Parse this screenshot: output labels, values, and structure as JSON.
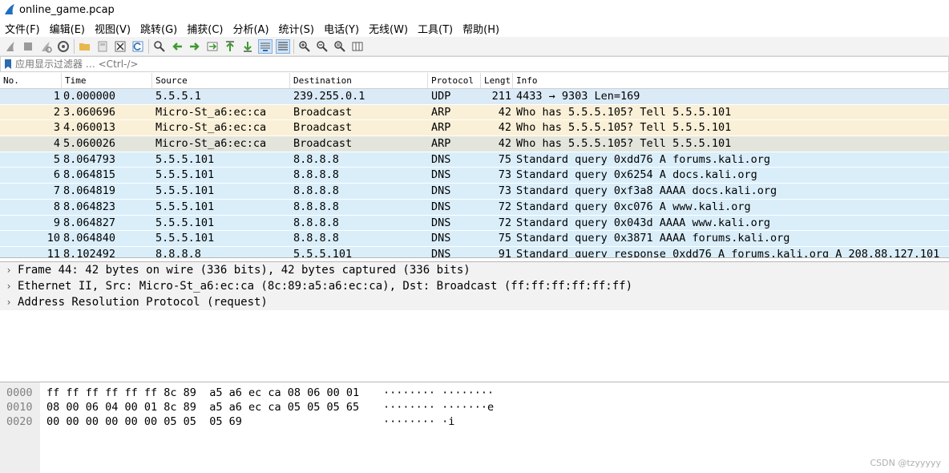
{
  "window": {
    "title": "online_game.pcap"
  },
  "menu": [
    "文件(F)",
    "编辑(E)",
    "视图(V)",
    "跳转(G)",
    "捕获(C)",
    "分析(A)",
    "统计(S)",
    "电话(Y)",
    "无线(W)",
    "工具(T)",
    "帮助(H)"
  ],
  "filter": {
    "placeholder": "应用显示过滤器 … <Ctrl-/>"
  },
  "packet_list": {
    "columns": [
      "No.",
      "Time",
      "Source",
      "Destination",
      "Protocol",
      "Lengt",
      "Info"
    ],
    "rows": [
      {
        "no": "1",
        "time": "0.000000",
        "src": "5.5.5.1",
        "dst": "239.255.0.1",
        "proto": "UDP",
        "len": "211",
        "info": "4433 → 9303 Len=169",
        "bg": "#dbeaf7"
      },
      {
        "no": "2",
        "time": "3.060696",
        "src": "Micro-St_a6:ec:ca",
        "dst": "Broadcast",
        "proto": "ARP",
        "len": "42",
        "info": "Who has 5.5.5.105? Tell 5.5.5.101",
        "bg": "#faf0d7"
      },
      {
        "no": "3",
        "time": "4.060013",
        "src": "Micro-St_a6:ec:ca",
        "dst": "Broadcast",
        "proto": "ARP",
        "len": "42",
        "info": "Who has 5.5.5.105? Tell 5.5.5.101",
        "bg": "#faf0d7"
      },
      {
        "no": "4",
        "time": "5.060026",
        "src": "Micro-St_a6:ec:ca",
        "dst": "Broadcast",
        "proto": "ARP",
        "len": "42",
        "info": "Who has 5.5.5.105? Tell 5.5.5.101",
        "bg": "#e3e5dc"
      },
      {
        "no": "5",
        "time": "8.064793",
        "src": "5.5.5.101",
        "dst": "8.8.8.8",
        "proto": "DNS",
        "len": "75",
        "info": "Standard query 0xdd76 A forums.kali.org",
        "bg": "#daeefa"
      },
      {
        "no": "6",
        "time": "8.064815",
        "src": "5.5.5.101",
        "dst": "8.8.8.8",
        "proto": "DNS",
        "len": "73",
        "info": "Standard query 0x6254 A docs.kali.org",
        "bg": "#daeefa"
      },
      {
        "no": "7",
        "time": "8.064819",
        "src": "5.5.5.101",
        "dst": "8.8.8.8",
        "proto": "DNS",
        "len": "73",
        "info": "Standard query 0xf3a8 AAAA docs.kali.org",
        "bg": "#daeefa"
      },
      {
        "no": "8",
        "time": "8.064823",
        "src": "5.5.5.101",
        "dst": "8.8.8.8",
        "proto": "DNS",
        "len": "72",
        "info": "Standard query 0xc076 A www.kali.org",
        "bg": "#daeefa"
      },
      {
        "no": "9",
        "time": "8.064827",
        "src": "5.5.5.101",
        "dst": "8.8.8.8",
        "proto": "DNS",
        "len": "72",
        "info": "Standard query 0x043d AAAA www.kali.org",
        "bg": "#daeefa"
      },
      {
        "no": "10",
        "time": "8.064840",
        "src": "5.5.5.101",
        "dst": "8.8.8.8",
        "proto": "DNS",
        "len": "75",
        "info": "Standard query 0x3871 AAAA forums.kali.org",
        "bg": "#daeefa"
      },
      {
        "no": "11",
        "time": "8.102492",
        "src": "8.8.8.8",
        "dst": "5.5.5.101",
        "proto": "DNS",
        "len": "91",
        "info": "Standard query response 0xdd76 A forums.kali.org A 208.88.127.101",
        "bg": "#daeefa"
      }
    ]
  },
  "details": [
    "Frame 44: 42 bytes on wire (336 bits), 42 bytes captured (336 bits)",
    "Ethernet II, Src: Micro-St_a6:ec:ca (8c:89:a5:a6:ec:ca), Dst: Broadcast (ff:ff:ff:ff:ff:ff)",
    "Address Resolution Protocol (request)"
  ],
  "bytes": [
    {
      "offset": "0000",
      "hex": "ff ff ff ff ff ff 8c 89  a5 a6 ec ca 08 06 00 01",
      "ascii": "········ ········"
    },
    {
      "offset": "0010",
      "hex": "08 00 06 04 00 01 8c 89  a5 a6 ec ca 05 05 05 65",
      "ascii": "········ ·······e"
    },
    {
      "offset": "0020",
      "hex": "00 00 00 00 00 00 05 05  05 69",
      "ascii": "········ ·i"
    }
  ],
  "watermark": "CSDN @tzyyyyy",
  "colors": {
    "toolbar_bg": "#f3f3f3",
    "details_bg": "#f2f2f2",
    "bytes_gutter": "#eeeeee",
    "app_icon": "#1f6fbf"
  }
}
